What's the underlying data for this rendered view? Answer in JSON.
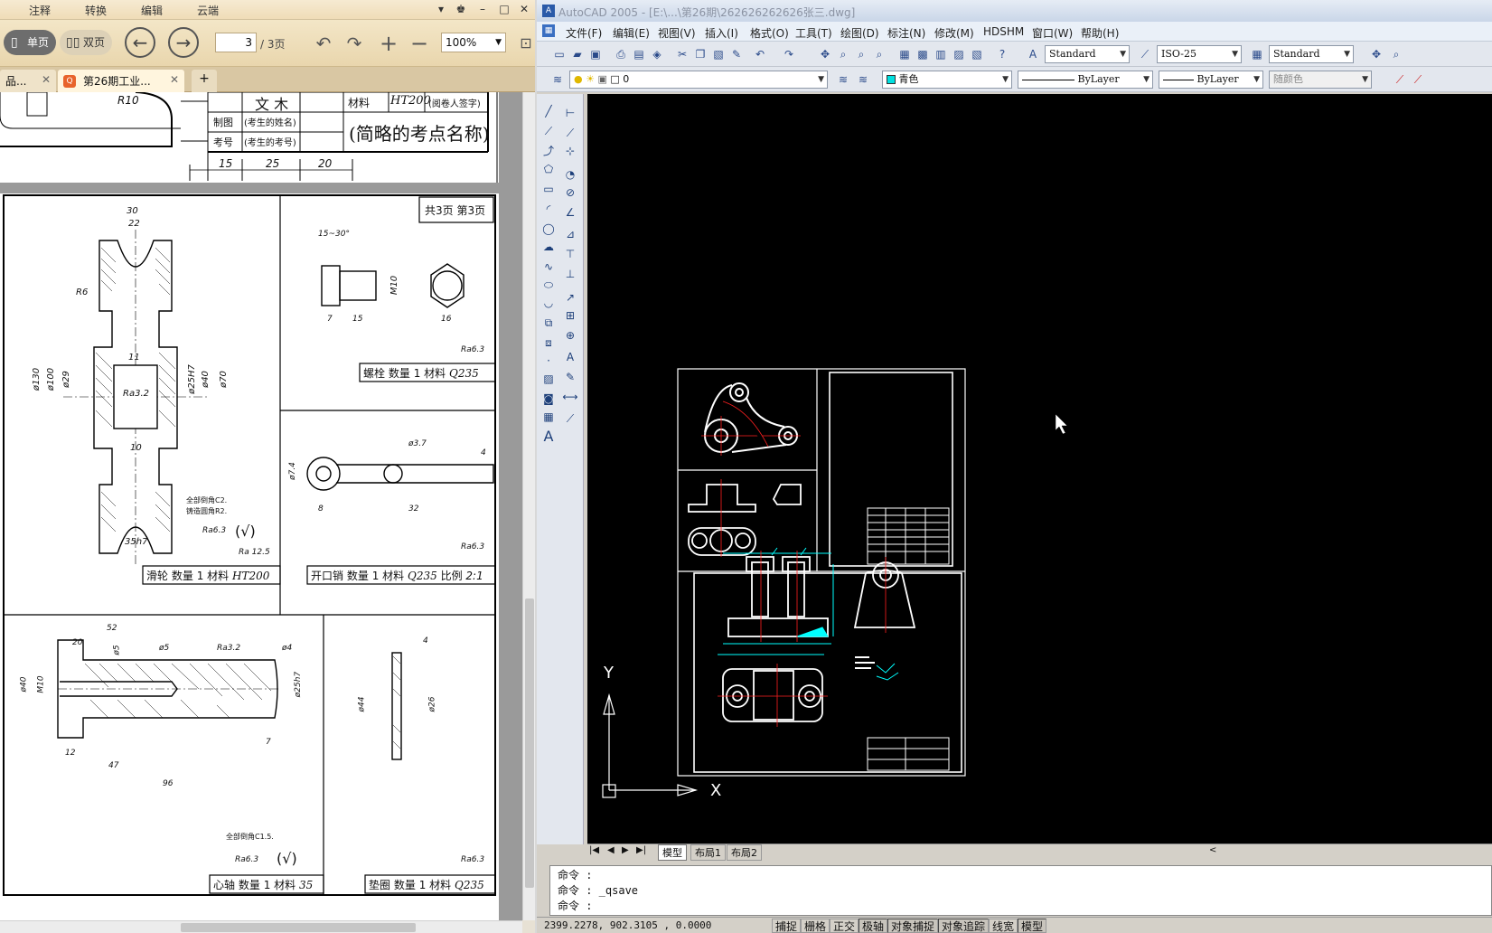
{
  "reader": {
    "menu": [
      "注释",
      "转换",
      "编辑",
      "云端"
    ],
    "window_controls": [
      "▾",
      "♚",
      "–",
      "□",
      "✕"
    ],
    "toolbar": {
      "single_page": "单页",
      "double_page": "双页",
      "page_current": "3",
      "page_total": "/ 3页",
      "zoom": "100%"
    },
    "tabs": [
      {
        "label": "品...",
        "close": "✕"
      },
      {
        "label": "第26期工业...",
        "close": "✕"
      },
      {
        "label": "+"
      }
    ],
    "title_block": {
      "doc_name": "文 木",
      "material_label": "材料",
      "material_value": "HT200",
      "reviewer": "(阅卷人签字)",
      "drawn_label": "制图",
      "drawn_value": "(考生的姓名)",
      "id_label": "考号",
      "id_value": "(考生的考号)",
      "point_name": "(简略的考点名称)",
      "dims": [
        "15",
        "25",
        "20"
      ],
      "r10": "R10"
    },
    "sheet": {
      "page_label": "共3页 第3页",
      "parts": [
        {
          "name": "螺栓",
          "qty_label": "数量",
          "qty": "1",
          "mat_label": "材料",
          "mat": "Q235"
        },
        {
          "name": "滑轮",
          "qty_label": "数量",
          "qty": "1",
          "mat_label": "材料",
          "mat": "HT200"
        },
        {
          "name": "开口销",
          "qty_label": "数量",
          "qty": "1",
          "mat_label": "材料",
          "mat": "Q235",
          "scale_label": "比例",
          "scale": "2:1"
        },
        {
          "name": "心轴",
          "qty_label": "数量",
          "qty": "1",
          "mat_label": "材料",
          "mat": "35"
        },
        {
          "name": "垫圈",
          "qty_label": "数量",
          "qty": "1",
          "mat_label": "材料",
          "mat": "Q235"
        }
      ],
      "pulley_dims": [
        "30",
        "22",
        "R6",
        "ø130",
        "ø100",
        "ø29",
        "11",
        "Ra3.2",
        "ø25H7",
        "ø40",
        "ø70",
        "10",
        "35h7",
        "Ra6.3",
        "Ra 12.5"
      ],
      "pulley_notes": [
        "全部倒角C2.",
        "铸造圆角R2."
      ],
      "bolt_dims": [
        "15~30°",
        "M10",
        "7",
        "15",
        "16",
        "Ra6.3"
      ],
      "pin_dims": [
        "ø3.7",
        "4",
        "ø7.4",
        "8",
        "32",
        "Ra6.3"
      ],
      "axle_dims": [
        "52",
        "20",
        "ø5",
        "ø5",
        "Ra3.2",
        "ø4",
        "ø40",
        "M10",
        "ø25h7",
        "7",
        "12",
        "47",
        "96",
        "Ra6.3"
      ],
      "axle_note": "全部倒角C1.5.",
      "washer_dims": [
        "4",
        "ø44",
        "ø26",
        "Ra6.3"
      ],
      "check_mark": "(√)"
    }
  },
  "acad": {
    "title": "AutoCAD 2005 - [E:\\...\\第26期\\262626262626张三.dwg]",
    "menu": [
      "文件(F)",
      "编辑(E)",
      "视图(V)",
      "插入(I)",
      "格式(O)",
      "工具(T)",
      "绘图(D)",
      "标注(N)",
      "修改(M)",
      "HDSHM",
      "窗口(W)",
      "帮助(H)"
    ],
    "styles": {
      "text": "Standard",
      "dim": "ISO-25",
      "table": "Standard"
    },
    "layer": "0",
    "color": "青色",
    "linetype": "ByLayer",
    "lineweight": "ByLayer",
    "plotstyle": "随颜色",
    "layout_tabs": [
      "模型",
      "布局1",
      "布局2"
    ],
    "command_lines": [
      "命令 :",
      "命令 :  _qsave",
      "命令 :"
    ],
    "coords": "2399.2278, 902.3105 , 0.0000",
    "status_buttons": [
      {
        "label": "捕捉",
        "on": false
      },
      {
        "label": "栅格",
        "on": false
      },
      {
        "label": "正交",
        "on": false
      },
      {
        "label": "极轴",
        "on": true
      },
      {
        "label": "对象捕捉",
        "on": true
      },
      {
        "label": "对象追踪",
        "on": true
      },
      {
        "label": "线宽",
        "on": false
      },
      {
        "label": "模型",
        "on": true
      }
    ],
    "ucs": {
      "y": "Y",
      "x": "X"
    },
    "colors": {
      "canvas": "#000000",
      "frame": "#ffffff",
      "cyan": "#00ffff",
      "red": "#ff2020"
    }
  }
}
